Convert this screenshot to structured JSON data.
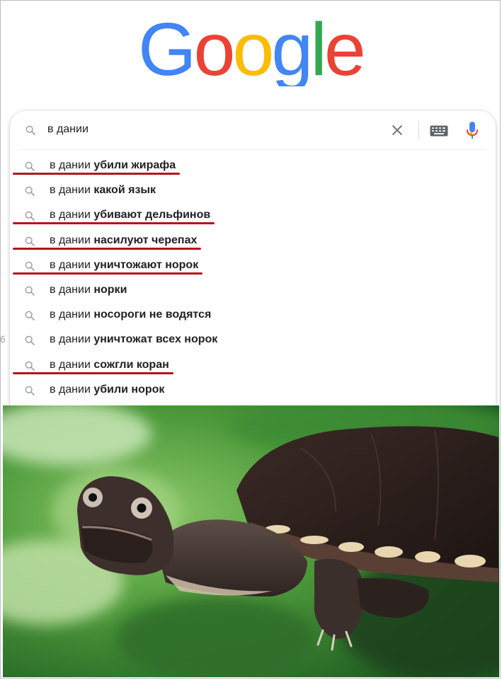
{
  "logo": {
    "letters": [
      "G",
      "o",
      "o",
      "g",
      "l",
      "e"
    ],
    "colors": [
      "#4285F4",
      "#EA4335",
      "#FBBC05",
      "#4285F4",
      "#34A853",
      "#EA4335"
    ]
  },
  "search": {
    "value": "в дании",
    "icons": [
      "search-icon",
      "close-icon",
      "keyboard-icon",
      "microphone-icon"
    ]
  },
  "suggestions": [
    {
      "prefix": "в дании ",
      "completion": "убили жирафа",
      "underlined": true
    },
    {
      "prefix": "в дании ",
      "completion": "какой язык",
      "underlined": false
    },
    {
      "prefix": "в дании ",
      "completion": "убивают дельфинов",
      "underlined": true
    },
    {
      "prefix": "в дании ",
      "completion": "насилуют черепах",
      "underlined": true
    },
    {
      "prefix": "в дании ",
      "completion": "уничтожают норок",
      "underlined": true
    },
    {
      "prefix": "в дании ",
      "completion": "норки",
      "underlined": false
    },
    {
      "prefix": "в дании ",
      "completion": "носороги не водятся",
      "underlined": false
    },
    {
      "prefix": "в дании ",
      "completion": "уничтожат всех норок",
      "underlined": false
    },
    {
      "prefix": "в дании ",
      "completion": "сожгли коран",
      "underlined": true
    },
    {
      "prefix": "в дании ",
      "completion": "убили норок",
      "underlined": false
    }
  ],
  "colors": {
    "underline": "#b4141b",
    "icon_gray": "#70757a",
    "text": "#202124"
  },
  "photo": {
    "subject": "turtle-photo"
  },
  "left_stub": "б"
}
